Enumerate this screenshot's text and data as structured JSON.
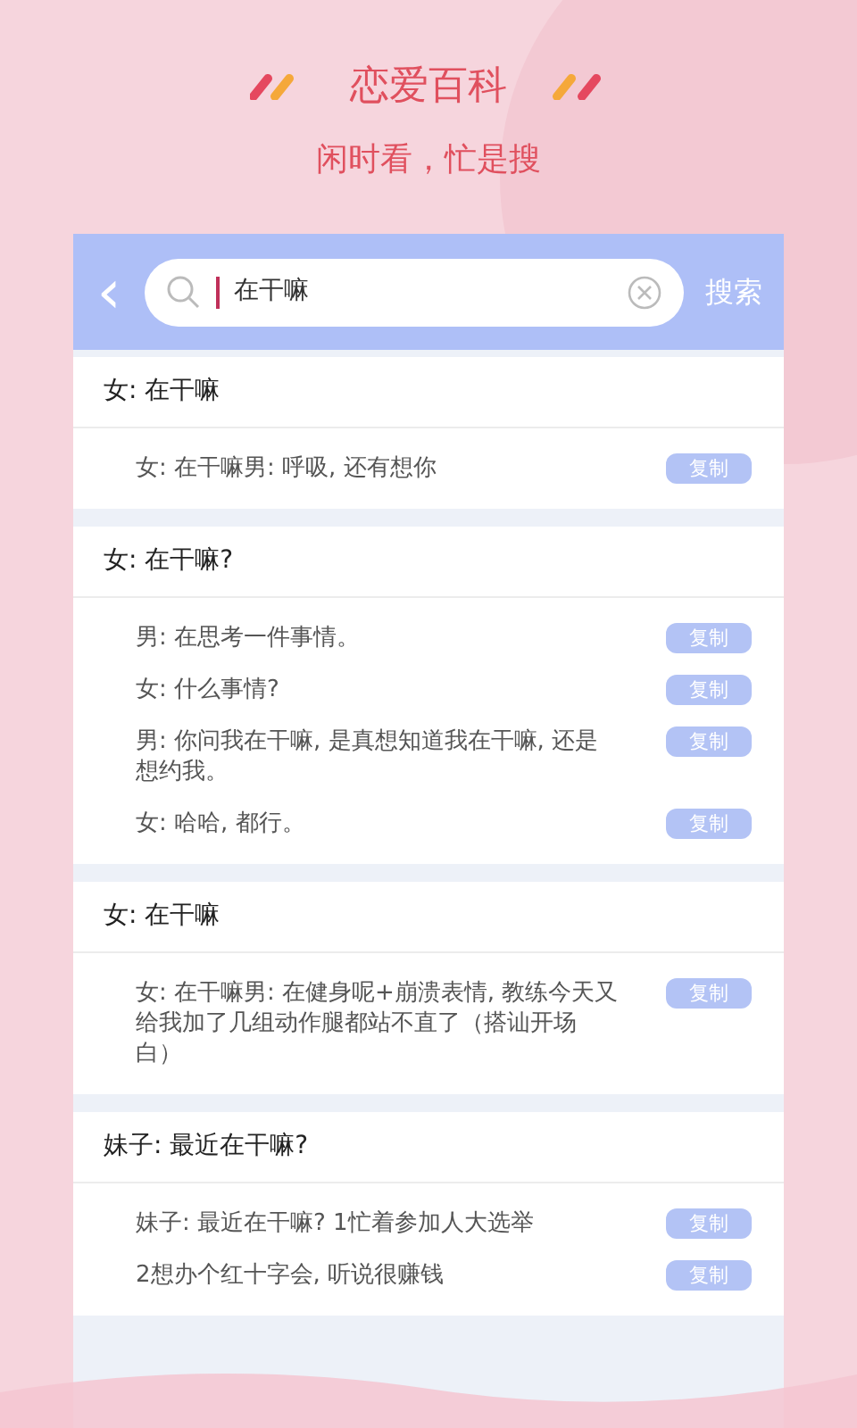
{
  "header": {
    "title": "恋爱百科",
    "subtitle": "闲时看，忙是搜"
  },
  "search": {
    "back": "‹",
    "value": "在干嘛",
    "button": "搜索"
  },
  "sections": [
    {
      "title": "女: 在干嘛",
      "items": [
        {
          "text": "女: 在干嘛男: 呼吸, 还有想你",
          "copy": "复制"
        }
      ]
    },
    {
      "title": "女: 在干嘛?",
      "items": [
        {
          "text": "男: 在思考一件事情。",
          "copy": "复制"
        },
        {
          "text": "女: 什么事情?",
          "copy": "复制"
        },
        {
          "text": "男: 你问我在干嘛, 是真想知道我在干嘛, 还是想约我。",
          "copy": "复制"
        },
        {
          "text": "女: 哈哈, 都行。",
          "copy": "复制"
        }
      ]
    },
    {
      "title": "女: 在干嘛",
      "items": [
        {
          "text": "女: 在干嘛男: 在健身呢+崩溃表情, 教练今天又给我加了几组动作腿都站不直了（搭讪开场白）",
          "copy": "复制"
        }
      ]
    },
    {
      "title": "妹子: 最近在干嘛?",
      "items": [
        {
          "text": "妹子: 最近在干嘛? 1忙着参加人大选举",
          "copy": "复制"
        },
        {
          "text": "2想办个红十字会, 听说很赚钱",
          "copy": "复制"
        }
      ]
    }
  ]
}
